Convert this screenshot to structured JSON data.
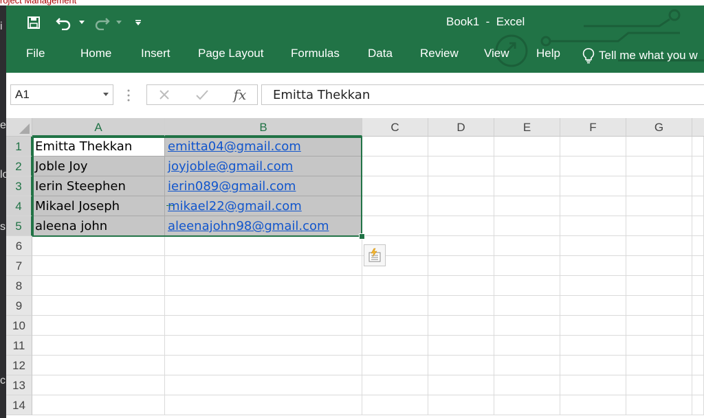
{
  "background": {
    "top_text": "roject Management",
    "left_letters": [
      "i",
      "e",
      "lo",
      "s",
      "ci"
    ]
  },
  "window": {
    "title": "Book1  -  Excel",
    "accent_color": "#217346"
  },
  "quick_access": {
    "icons": [
      "save-icon",
      "undo-icon",
      "undo-dropdown-icon",
      "redo-icon",
      "redo-dropdown-icon",
      "customize-qat-icon"
    ]
  },
  "ribbon": {
    "tabs": [
      "File",
      "Home",
      "Insert",
      "Page Layout",
      "Formulas",
      "Data",
      "Review",
      "View",
      "Help"
    ],
    "tell_me": "Tell me what you w"
  },
  "formula_bar": {
    "name_box": "A1",
    "fx_label": "fx",
    "value": "Emitta Thekkan"
  },
  "sheet": {
    "columns": [
      "A",
      "B",
      "C",
      "D",
      "E",
      "F",
      "G"
    ],
    "selected_columns": [
      "A",
      "B"
    ],
    "rows": [
      "1",
      "2",
      "3",
      "4",
      "5",
      "6",
      "7",
      "8",
      "9",
      "10",
      "11",
      "12",
      "13",
      "14"
    ],
    "selected_rows": [
      "1",
      "2",
      "3",
      "4",
      "5"
    ],
    "data": [
      {
        "name": "Emitta Thekkan",
        "email": "emitta04@gmail.com"
      },
      {
        "name": "Joble Joy",
        "email": "joyjoble@gmail.com"
      },
      {
        "name": "Ierin Steephen",
        "email": "ierin089@gmail.com"
      },
      {
        "name": "Mikael Joseph",
        "email": "mikael22@gmail.com"
      },
      {
        "name": "aleena john",
        "email": "aleenajohn98@gmail.com"
      }
    ],
    "link_color": "#1155cc"
  }
}
